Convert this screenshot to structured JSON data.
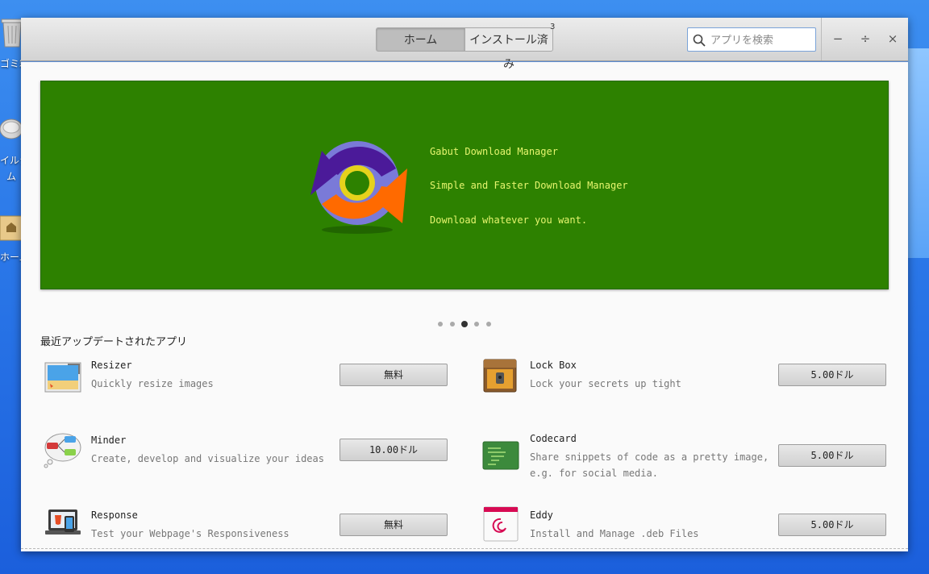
{
  "desktop": {
    "trash_label": "ゴミ箱",
    "filesystem_label_line1": "イルシ",
    "filesystem_label_line2": "ム",
    "home_label": "ホーム"
  },
  "header": {
    "tabs": [
      {
        "label": "ホーム",
        "active": true
      },
      {
        "label": "インストール済み",
        "active": false
      }
    ],
    "installed_badge": "3",
    "search_placeholder": "アプリを検索",
    "window_buttons": {
      "minimize": "−",
      "maximize": "÷",
      "close": "×"
    }
  },
  "banner": {
    "background": "#2d8100",
    "text_color": "#e6f56e",
    "app_name": "Gabut Download Manager",
    "tagline": "Simple and Faster Download Manager",
    "description": "Download whatever you want.",
    "carousel_count": 5,
    "carousel_active_index": 2
  },
  "recent": {
    "title": "最近アップデートされたアプリ",
    "apps": [
      {
        "name": "Resizer",
        "description": "Quickly resize images",
        "price": "無料",
        "icon": "resizer-icon"
      },
      {
        "name": "Lock Box",
        "description": "Lock your secrets up tight",
        "price": "5.00ドル",
        "icon": "lockbox-icon"
      },
      {
        "name": "Minder",
        "description": "Create, develop and visualize your ideas",
        "price": "10.00ドル",
        "icon": "minder-icon"
      },
      {
        "name": "Codecard",
        "description_line1": "Share snippets of code as a pretty image,",
        "description_line2": "e.g. for social media.",
        "price": "5.00ドル",
        "icon": "codecard-icon"
      },
      {
        "name": "Response",
        "description": "Test your Webpage's Responsiveness",
        "price": "無料",
        "icon": "response-icon"
      },
      {
        "name": "Eddy",
        "description": "Install and Manage .deb Files",
        "price": "5.00ドル",
        "icon": "eddy-icon"
      }
    ]
  }
}
